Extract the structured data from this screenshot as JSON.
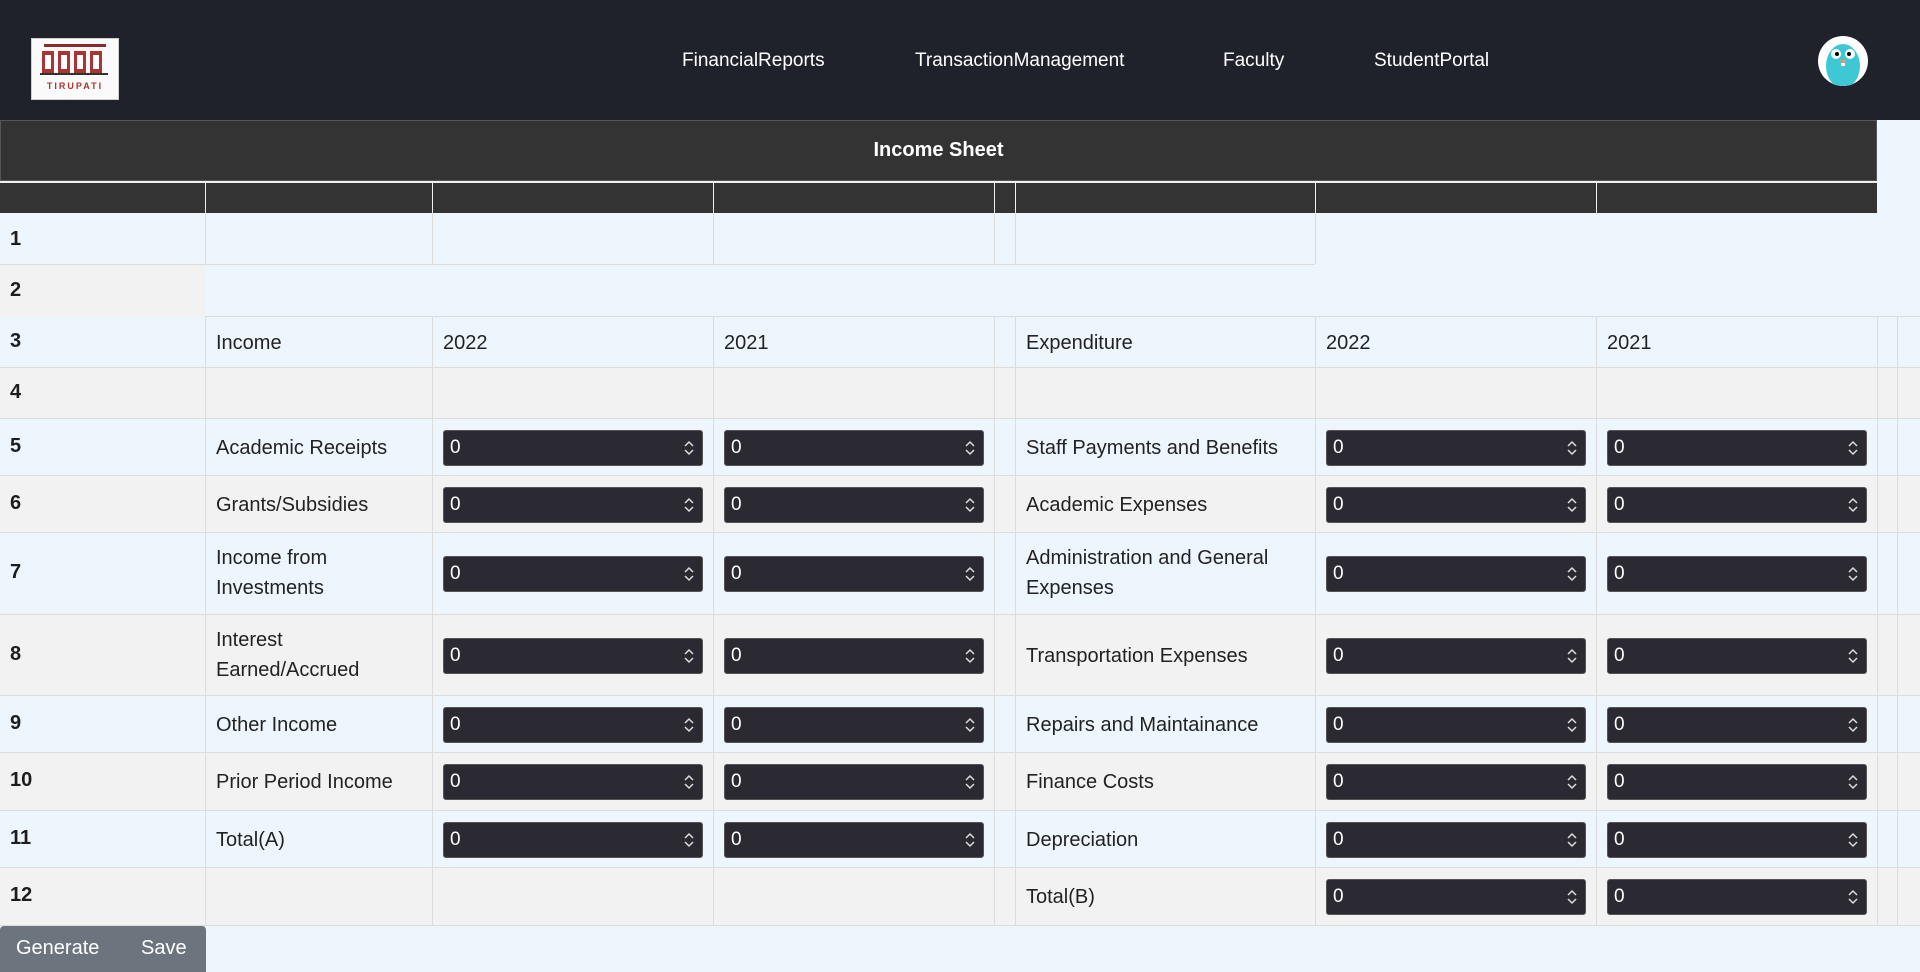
{
  "navbar": {
    "logo_text": "TIRUPATI",
    "links": [
      "FinancialReports",
      "TransactionManagement",
      "Faculty",
      "StudentPortal"
    ]
  },
  "sheet": {
    "title": "Income Sheet",
    "row_numbers": [
      "1",
      "2",
      "3",
      "4",
      "5",
      "6",
      "7",
      "8",
      "9",
      "10",
      "11",
      "12"
    ],
    "header": {
      "income": "Income",
      "income_y1": "2022",
      "income_y2": "2021",
      "expenditure": "Expenditure",
      "exp_y1": "2022",
      "exp_y2": "2021"
    },
    "income_items": [
      "Academic Receipts",
      "Grants/Subsidies",
      "Income from Investments",
      "Interest Earned/Accrued",
      "Other Income",
      "Prior Period Income",
      "Total(A)"
    ],
    "expenditure_items": [
      "Staff Payments and Benefits",
      "Academic Expenses",
      "Administration and General Expenses",
      "Transportation Expenses",
      "Repairs and Maintainance",
      "Finance Costs",
      "Depreciation",
      "Total(B)"
    ],
    "default_value": "0"
  },
  "actions": {
    "generate": "Generate",
    "save": "Save"
  }
}
